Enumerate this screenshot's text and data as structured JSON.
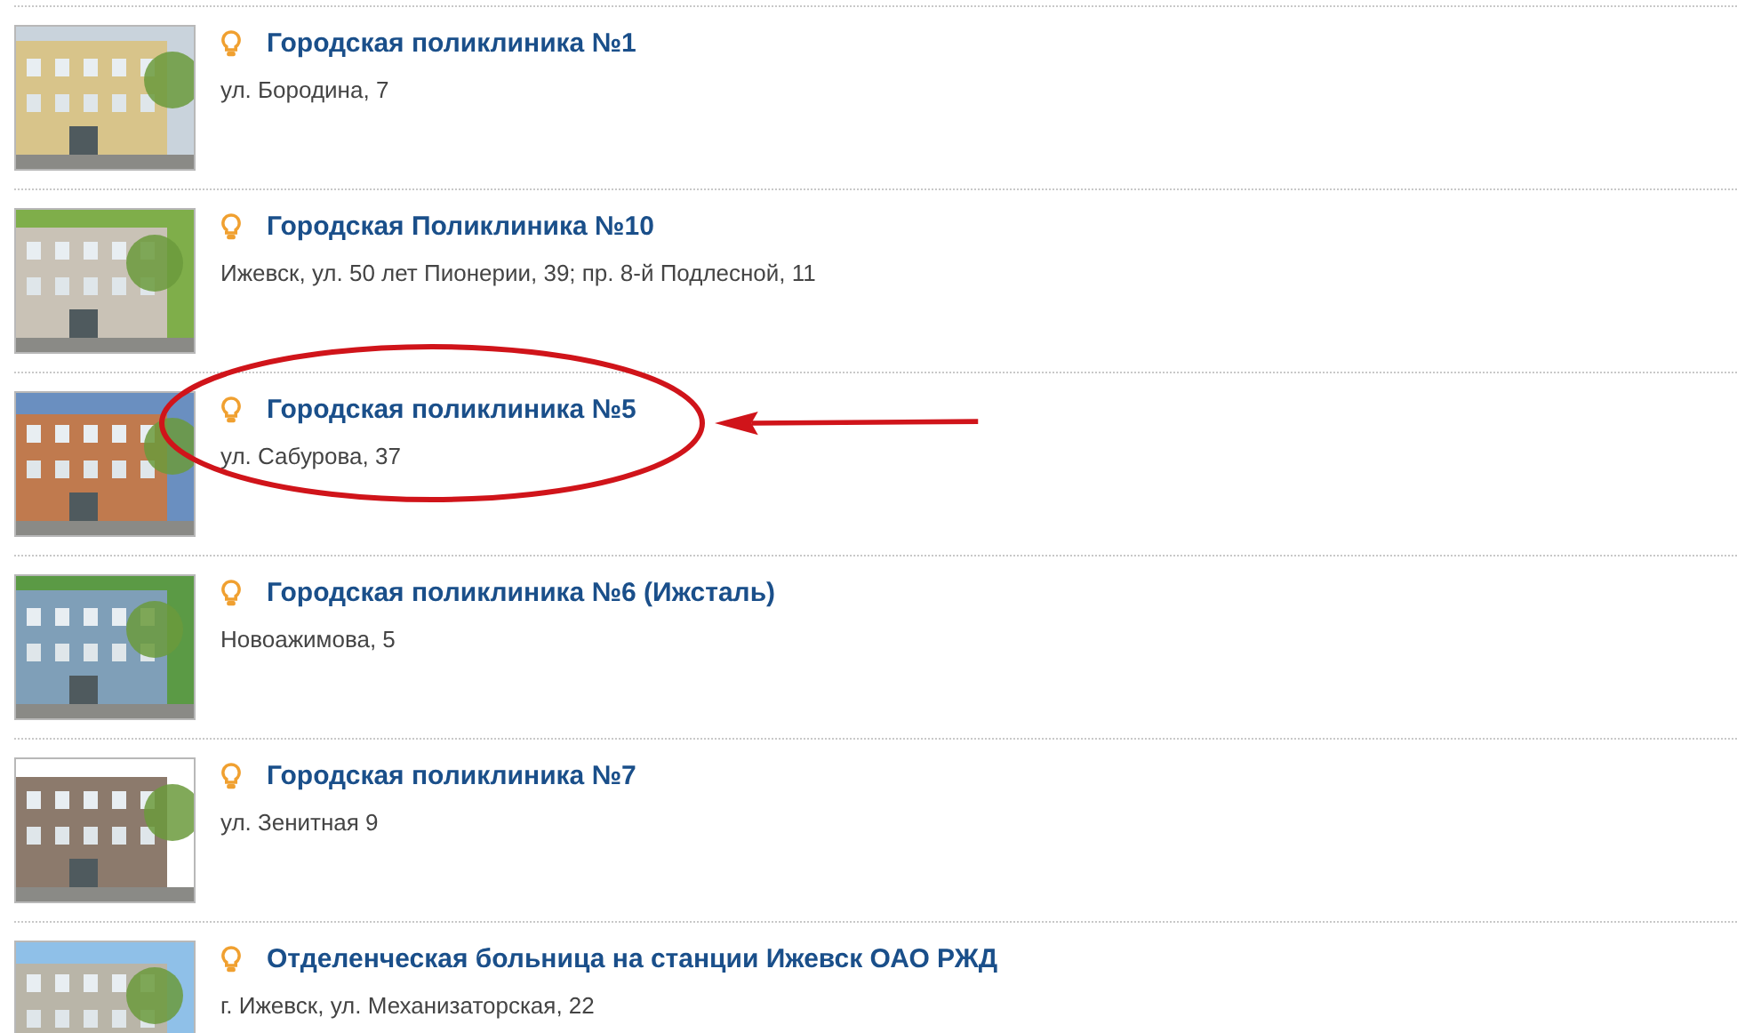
{
  "items": [
    {
      "title": "Городская поликлиника №1",
      "address": "ул. Бородина, 7",
      "highlighted": false
    },
    {
      "title": "Городская Поликлиника №10",
      "address": "Ижевск, ул. 50 лет Пионерии, 39; пр. 8-й Подлесной, 11",
      "highlighted": false
    },
    {
      "title": "Городская поликлиника №5",
      "address": "ул. Сабурова, 37",
      "highlighted": true
    },
    {
      "title": "Городская поликлиника №6 (Ижсталь)",
      "address": "Новоажимова, 5",
      "highlighted": false
    },
    {
      "title": "Городская поликлиника №7",
      "address": "ул. Зенитная 9",
      "highlighted": false
    },
    {
      "title": "Отделенческая больница на станции Ижевск ОАО РЖД",
      "address": "г. Ижевск, ул. Механизаторская, 22",
      "highlighted": false
    }
  ]
}
